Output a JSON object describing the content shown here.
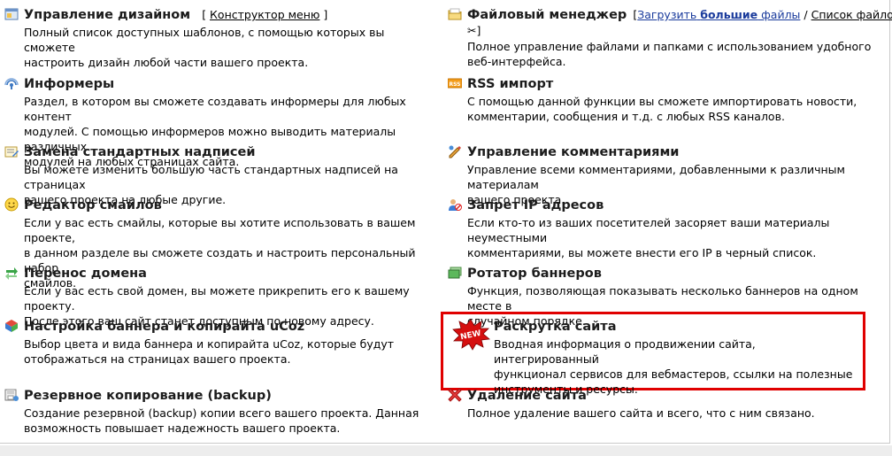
{
  "left": [
    {
      "title": "Управление дизайном",
      "links_before": "[ ",
      "link": "Конструктор меню",
      "links_after": " ]",
      "desc": [
        "Полный список доступных шаблонов, с помощью которых вы сможете",
        "настроить дизайн любой части вашего проекта."
      ],
      "icon": "design-icon"
    },
    {
      "title": "Информеры",
      "desc": [
        "Раздел, в котором вы сможете создавать информеры для любых контент",
        "модулей. С помощью информеров можно выводить материалы различных",
        "модулей на любых страницах сайта."
      ],
      "icon": "informer-icon"
    },
    {
      "title": "Замена стандартных надписей",
      "desc": [
        "Вы можете изменить большую часть стандартных надписей на страницах",
        "вашего проекта на любые другие."
      ],
      "icon": "text-replace-icon"
    },
    {
      "title": "Редактор смайлов",
      "desc": [
        "Если у вас есть смайлы, которые вы хотите использовать в вашем проекте,",
        "в данном разделе вы сможете создать и настроить персональный набор",
        "смайлов."
      ],
      "icon": "smiley-icon"
    },
    {
      "title": "Перенос домена",
      "desc": [
        "Если у вас есть свой домен, вы можете прикрепить его к вашему проекту.",
        "После этого ваш сайт станет доступным по новому адресу."
      ],
      "icon": "domain-transfer-icon"
    },
    {
      "title": "Настройка баннера и копирайта uCoz",
      "desc": [
        "Выбор цвета и вида баннера и копирайта uCoz, которые будут",
        "отображаться на страницах вашего проекта."
      ],
      "icon": "banner-settings-icon"
    },
    {
      "title": "Резервное копирование (backup)",
      "desc": [
        "Создание резервной (backup) копии всего вашего проекта. Данная",
        "возможность повышает надежность вашего проекта."
      ],
      "icon": "backup-icon"
    }
  ],
  "right": [
    {
      "title": "Файловый менеджер",
      "fm_open": "[",
      "fm_upload": "Загрузить",
      "fm_big": "большие",
      "fm_files": " файлы",
      "fm_sep1": " / ",
      "fm_list": "Список файлов",
      "fm_sep2": " /",
      "fm_close": "]",
      "desc": [
        "Полное управление файлами и папками с использованием удобного",
        "веб-интерфейса."
      ],
      "icon": "folder-icon"
    },
    {
      "title": "RSS импорт",
      "desc": [
        "С помощью данной функции вы сможете импортировать новости,",
        "комментарии, сообщения и т.д. с любых RSS каналов."
      ],
      "icon": "rss-icon"
    },
    {
      "title": "Управление комментариями",
      "desc": [
        "Управление всеми комментариями, добавленными к различным материалам",
        "вашего проекта."
      ],
      "icon": "comments-icon"
    },
    {
      "title": "Запрет IP адресов",
      "desc": [
        "Если кто-то из ваших посетителей засоряет ваши материалы неуместными",
        "комментариями, вы можете внести его IP в черный список."
      ],
      "icon": "ip-ban-icon"
    },
    {
      "title": "Ротатор баннеров",
      "desc": [
        "Функция, позволяющая показывать несколько баннеров на одном месте в",
        "случайном порядке."
      ],
      "icon": "banner-rotator-icon"
    },
    {
      "title": "Раскрутка сайта",
      "badge": "NEW",
      "desc": [
        "Вводная информация о продвижении сайта, интегрированный",
        "функционал сервисов для вебмастеров, ссылки на полезные",
        "инструменты и ресурсы."
      ],
      "icon": "new-badge-icon"
    },
    {
      "title": "Удаление сайта",
      "desc": [
        "Полное удаление вашего сайта и всего, что с ним связано."
      ],
      "icon": "delete-icon"
    }
  ],
  "colors": {
    "highlight": "#e00000",
    "link": "#1a3b9c",
    "title": "#1c1c1c"
  }
}
